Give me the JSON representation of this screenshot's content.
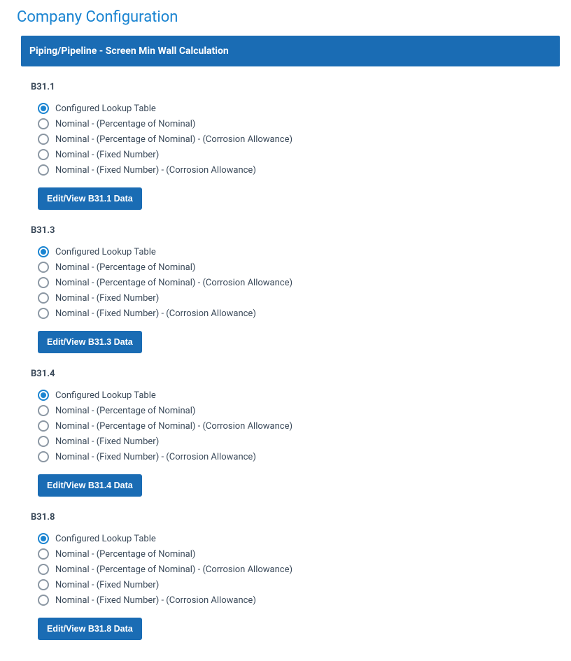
{
  "page_title": "Company Configuration",
  "panel_header": "Piping/Pipeline - Screen Min Wall Calculation",
  "options": [
    "Configured Lookup Table",
    "Nominal - (Percentage of Nominal)",
    "Nominal - (Percentage of Nominal) - (Corrosion Allowance)",
    "Nominal - (Fixed Number)",
    "Nominal - (Fixed Number) - (Corrosion Allowance)"
  ],
  "sections": [
    {
      "code": "B31.1",
      "selected": 0,
      "button_label": "Edit/View B31.1 Data"
    },
    {
      "code": "B31.3",
      "selected": 0,
      "button_label": "Edit/View B31.3 Data"
    },
    {
      "code": "B31.4",
      "selected": 0,
      "button_label": "Edit/View B31.4 Data"
    },
    {
      "code": "B31.8",
      "selected": 0,
      "button_label": "Edit/View B31.8 Data"
    }
  ]
}
